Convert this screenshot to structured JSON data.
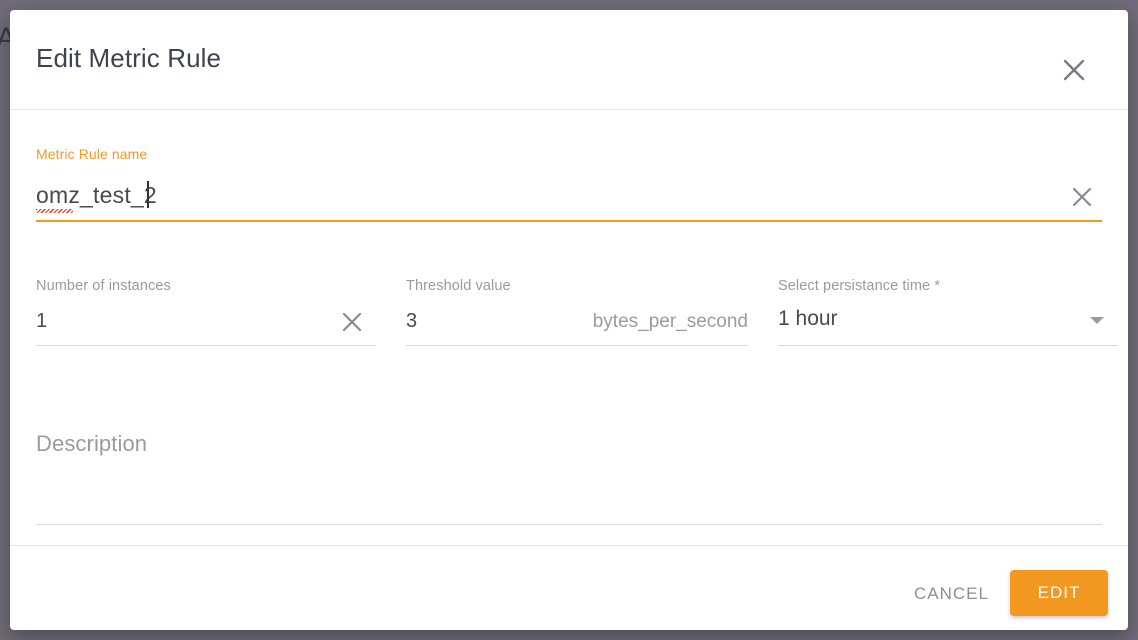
{
  "backdrop": {
    "color": "#6f6b78",
    "partial_text": "A"
  },
  "dialog": {
    "title": "Edit Metric Rule",
    "close_icon": "close-icon",
    "accent_color": "#f2971f"
  },
  "form": {
    "name_field": {
      "label": "Metric Rule name",
      "value": "omz_test_2",
      "clear_icon": "close-icon",
      "focused": true,
      "spellcheck_error": "omz"
    },
    "instances_field": {
      "label": "Number of instances",
      "value": "1",
      "clear_icon": "close-icon"
    },
    "threshold_field": {
      "label": "Threshold value",
      "value": "3",
      "suffix": "bytes_per_second"
    },
    "persistance_field": {
      "label": "Select persistance time *",
      "value": "1 hour",
      "caret_icon": "chevron-down-icon"
    },
    "description_field": {
      "placeholder": "Description",
      "value": ""
    }
  },
  "footer": {
    "cancel_label": "CANCEL",
    "edit_label": "EDIT"
  }
}
